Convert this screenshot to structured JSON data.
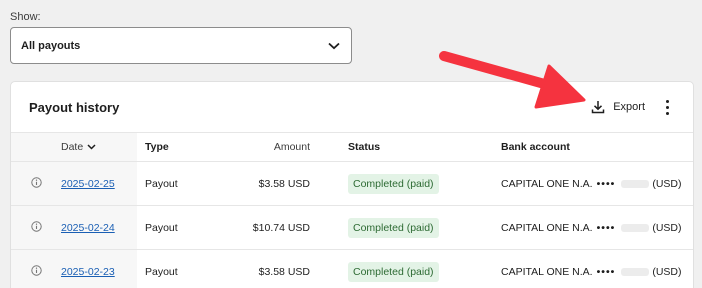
{
  "filter": {
    "label": "Show:",
    "value": "All payouts"
  },
  "card": {
    "title": "Payout history",
    "export_label": "Export"
  },
  "table": {
    "headers": {
      "date": "Date",
      "type": "Type",
      "amount": "Amount",
      "status": "Status",
      "bank": "Bank account"
    },
    "rows": [
      {
        "date": "2025-02-25",
        "type": "Payout",
        "amount": "$3.58 USD",
        "status": "Completed (paid)",
        "bank_name": "CAPITAL ONE N.A.",
        "bank_mask": "••••",
        "currency": "(USD)"
      },
      {
        "date": "2025-02-24",
        "type": "Payout",
        "amount": "$10.74 USD",
        "status": "Completed (paid)",
        "bank_name": "CAPITAL ONE N.A.",
        "bank_mask": "••••",
        "currency": "(USD)"
      },
      {
        "date": "2025-02-23",
        "type": "Payout",
        "amount": "$3.58 USD",
        "status": "Completed (paid)",
        "bank_name": "CAPITAL ONE N.A.",
        "bank_mask": "••••",
        "currency": "(USD)"
      }
    ]
  },
  "colors": {
    "annotation_arrow": "#f5333f",
    "link": "#1a5fb4",
    "badge_bg": "#e3f3e6",
    "badge_text": "#2e6b34"
  },
  "icons": {
    "select": "chevron-down-icon",
    "export": "download-icon",
    "menu": "more-vertical-icon",
    "sort": "chevron-down-icon",
    "row": "info-icon"
  }
}
